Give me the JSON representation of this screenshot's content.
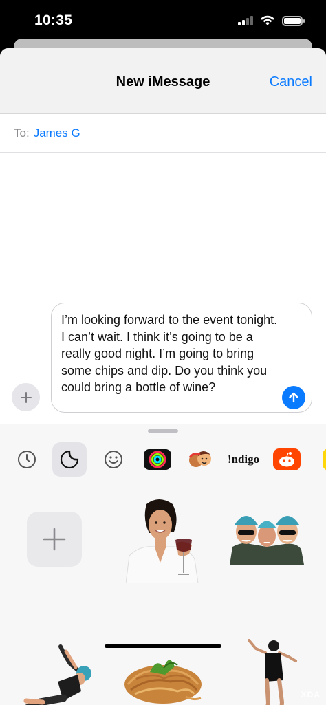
{
  "status_bar": {
    "time": "10:35"
  },
  "header": {
    "title": "New iMessage",
    "cancel_label": "Cancel"
  },
  "recipient": {
    "label": "To:",
    "name": "James G"
  },
  "message": {
    "text": "I’m looking forward to the event tonight. I can’t wait. I think it’s going to be a really good night. I’m going to bring some chips and dip. Do you think you could bring a bottle of wine?"
  },
  "app_drawer": {
    "apps": [
      {
        "name": "recents-icon"
      },
      {
        "name": "stickers-icon",
        "selected": true
      },
      {
        "name": "emoji-icon"
      },
      {
        "name": "fitness-icon"
      },
      {
        "name": "memoji-icon"
      },
      {
        "name": "indigo-app-icon",
        "label": "!ndigo"
      },
      {
        "name": "reddit-app-icon"
      },
      {
        "name": "partial-app-icon"
      }
    ]
  },
  "stickers": [
    {
      "name": "add-sticker-button"
    },
    {
      "name": "sticker-woman-with-wine"
    },
    {
      "name": "sticker-three-helmets-selfie"
    },
    {
      "name": "sticker-zipline-person"
    },
    {
      "name": "sticker-spaghetti"
    },
    {
      "name": "sticker-dancing-person"
    }
  ],
  "watermark": "XDA",
  "colors": {
    "accent": "#0a7aff",
    "nav_bg": "#f2f2f3",
    "tray_bg": "#f7f7f8"
  }
}
